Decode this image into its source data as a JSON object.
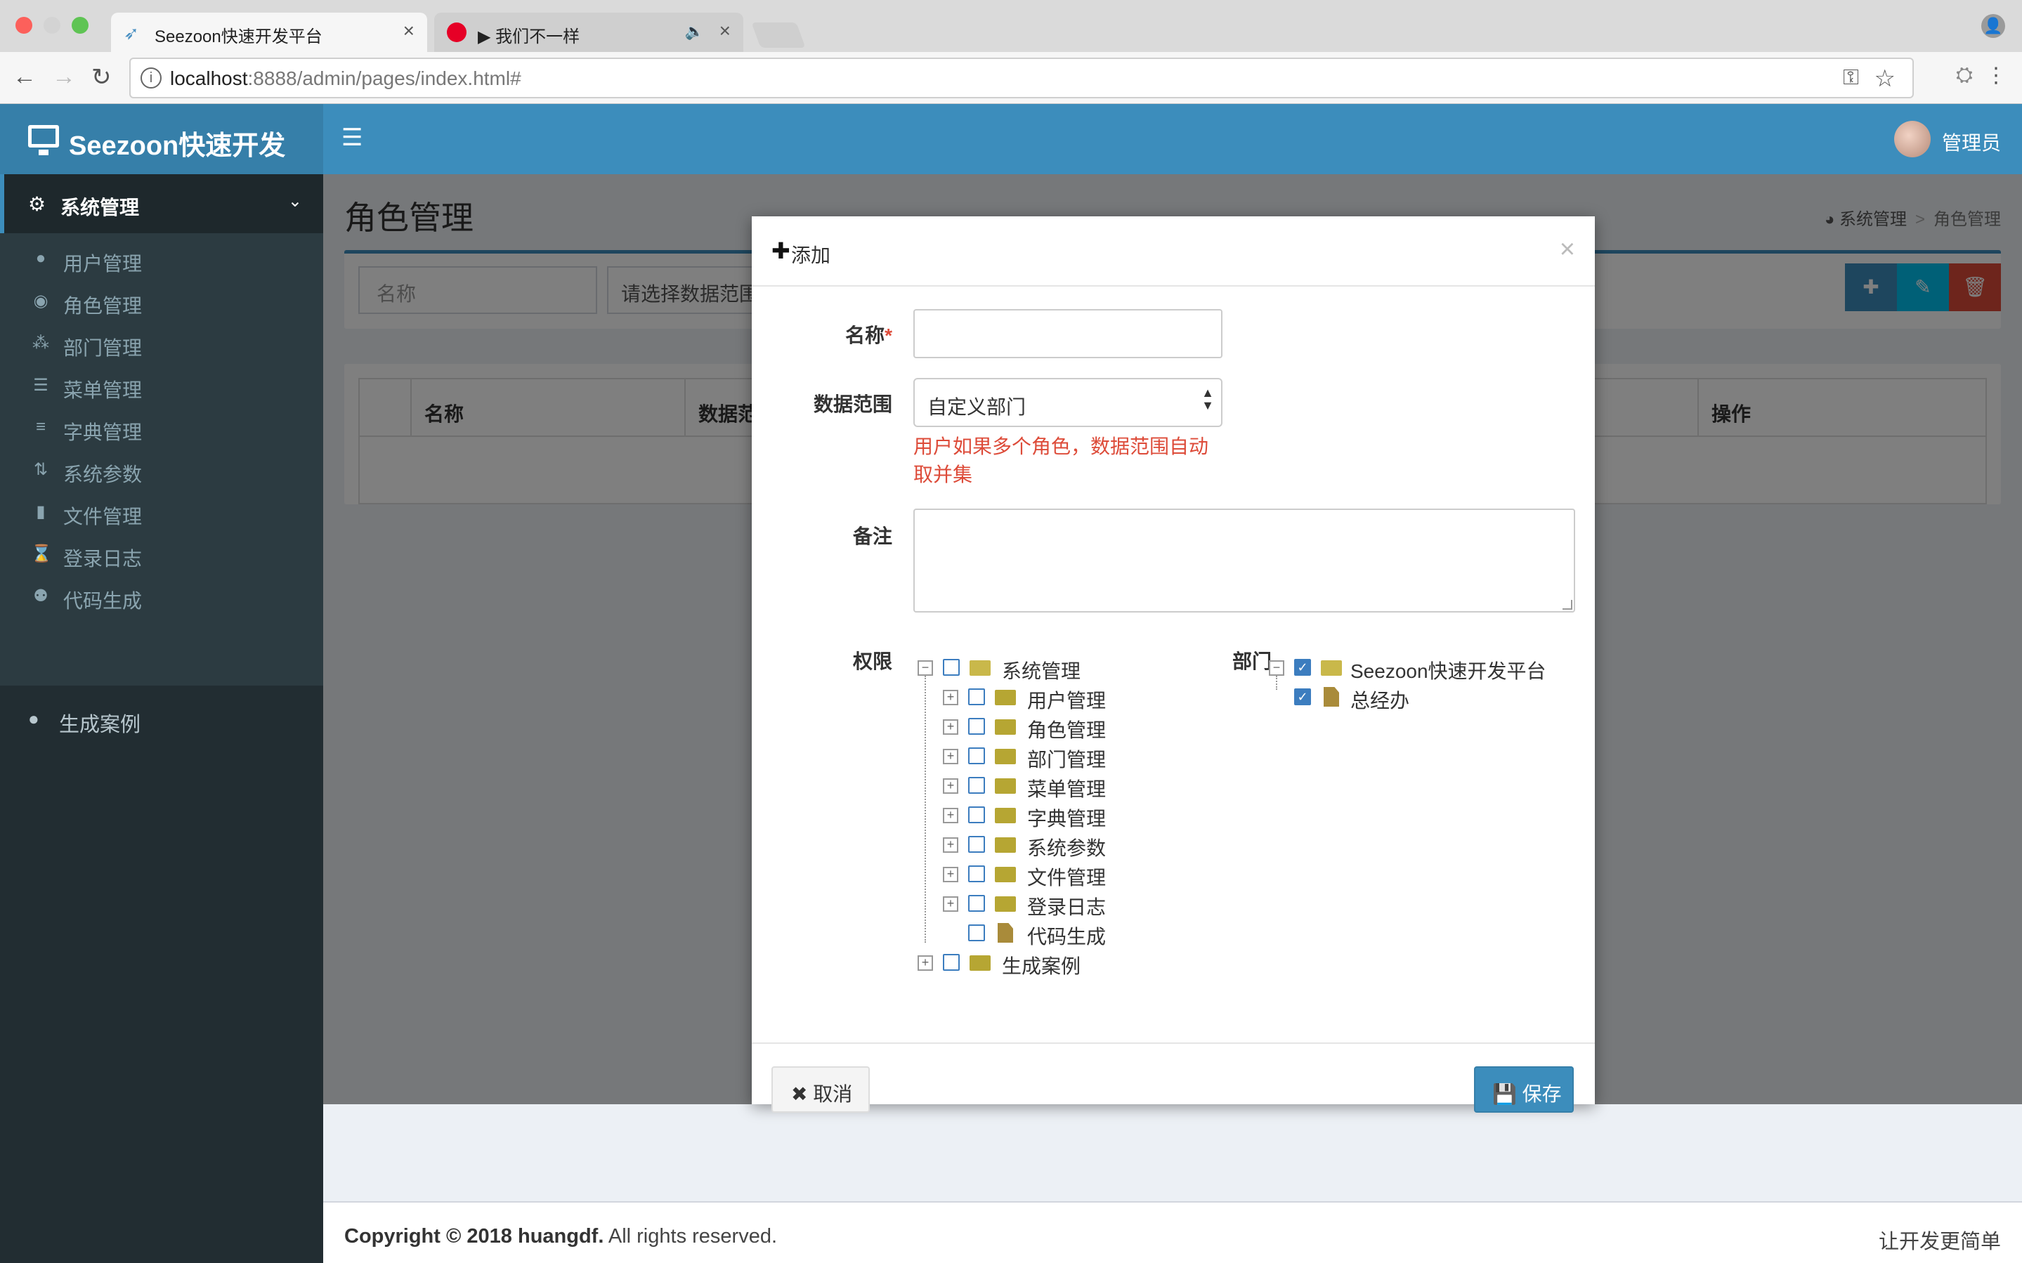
{
  "browser": {
    "tabs": [
      {
        "title": "Seezoon快速开发平台",
        "active": true
      },
      {
        "title": "▶ 我们不一样",
        "active": false
      }
    ],
    "address": {
      "host": "localhost",
      "path": ":8888/admin/pages/index.html#"
    }
  },
  "header": {
    "logo": "Seezoon快速开发",
    "user": "管理员"
  },
  "sidebar": {
    "section": "系统管理",
    "items": [
      {
        "label": "用户管理",
        "icon": "user-icon"
      },
      {
        "label": "角色管理",
        "icon": "user-secret-icon"
      },
      {
        "label": "部门管理",
        "icon": "sitemap-icon"
      },
      {
        "label": "菜单管理",
        "icon": "list-icon"
      },
      {
        "label": "字典管理",
        "icon": "database-icon"
      },
      {
        "label": "系统参数",
        "icon": "arrows-icon"
      },
      {
        "label": "文件管理",
        "icon": "file-icon"
      },
      {
        "label": "登录日志",
        "icon": "hourglass-icon"
      },
      {
        "label": "代码生成",
        "icon": "code-icon"
      }
    ],
    "extra": "生成案例"
  },
  "content": {
    "title": "角色管理",
    "breadcrumb": [
      "系统管理",
      ">",
      "角色管理"
    ],
    "search": {
      "name_placeholder": "名称",
      "scope_placeholder": "请选择数据范围"
    },
    "table": {
      "columns": [
        "名称",
        "数据范",
        "操作"
      ]
    }
  },
  "footer": {
    "copyright": "Copyright © 2018 huangdf.",
    "rights": " All rights reserved.",
    "slogan": "让开发更简单"
  },
  "modal": {
    "title": "添加",
    "fields": {
      "name_label": "名称",
      "name_required": "*",
      "name_value": "",
      "scope_label": "数据范围",
      "scope_value": "自定义部门",
      "scope_help": "用户如果多个角色，数据范围自动取并集",
      "remark_label": "备注",
      "remark_value": "",
      "perm_label": "权限",
      "dept_label": "部门"
    },
    "perm_tree": {
      "root": "系统管理",
      "children": [
        "用户管理",
        "角色管理",
        "部门管理",
        "菜单管理",
        "字典管理",
        "系统参数",
        "文件管理",
        "登录日志",
        "代码生成"
      ],
      "sibling": "生成案例"
    },
    "dept_tree": {
      "root": "Seezoon快速开发平台",
      "child": "总经办",
      "root_checked": true,
      "child_checked": true
    },
    "buttons": {
      "cancel": "取消",
      "save": "保存"
    }
  },
  "colors": {
    "primary": "#3c8dbc",
    "sidebar": "#222d32",
    "danger": "#dd4b39",
    "folder": "#b6a633"
  }
}
